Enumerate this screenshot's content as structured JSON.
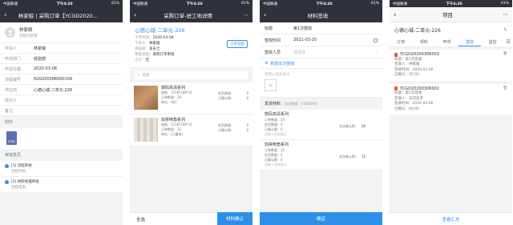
{
  "status": {
    "carrier": "中国联通",
    "time": "下午4:20",
    "battery": "61%"
  },
  "p1": {
    "nav_title": "林家娘 | 采购订单【YCGD2020…",
    "user_name": "林家娘",
    "user_status": "流程已结束",
    "fields": [
      {
        "label": "申请人",
        "value": "林家娘"
      },
      {
        "label": "申请部门",
        "value": "体验部"
      },
      {
        "label": "申请日期",
        "value": "2020-03-06"
      },
      {
        "label": "流程编号",
        "value": "N20200306000156"
      },
      {
        "label": "供应商",
        "value": "心德心城-二单元-226"
      },
      {
        "label": "经办人",
        "value": ""
      },
      {
        "label": "备注",
        "value": ""
      }
    ],
    "attach_title": "附件",
    "attach_label": "HTML",
    "approval_title": "审批意见",
    "approvals": [
      {
        "tag": "[1] 流程开始",
        "detail": "流程开始"
      },
      {
        "tag": "[2] 材料经理审批",
        "detail": "流程结束"
      }
    ]
  },
  "p2": {
    "nav_title": "采购订单-进工地详情",
    "header_title": "心德心城-二单元-226",
    "meta": [
      {
        "label": "下单时间：",
        "value": "2020-03-06"
      },
      {
        "label": "下单人：",
        "value": "林家娘"
      },
      {
        "label": "供应商：",
        "value": "多乐士"
      },
      {
        "label": "审批流程：",
        "value": "采购订单审批"
      },
      {
        "label": "小计：",
        "value": "无"
      }
    ],
    "order_btn": "订单追踪",
    "search_placeholder": "搜索",
    "products": [
      {
        "name": "数码高清系列",
        "spec": "规格：1218*168*12",
        "qty": "订单数量：20",
        "unit": "单位：[块]",
        "sent_label": "发货数量：",
        "sent": "0",
        "confirm_label": "已确认数：",
        "confirm": "0"
      },
      {
        "name": "双拼倒角系列",
        "spec": "规格：1218*168*12",
        "qty": "订单数量：15",
        "unit": "单位：[儿童房]",
        "sent_label": "发货数量：",
        "sent": "0",
        "confirm_label": "已确认数：",
        "confirm": "0"
      }
    ],
    "select_all": "全选",
    "confirm_btn": "材料确认"
  },
  "p3": {
    "nav_title": "材料签收",
    "fields": [
      {
        "label": "标题",
        "value": "第1次签收"
      },
      {
        "label": "签收时间",
        "value": "2021-03-25"
      },
      {
        "label": "签收人员",
        "value": "请选择"
      }
    ],
    "add_signer": "新增本次签收",
    "upload_hint": "请输入签收备注",
    "section_title": "发货材料",
    "section_sub": "（发货数量：0.000000）",
    "items": [
      {
        "name": "数码高清系列",
        "qty": "订单数量：20",
        "sent": "发货数量：0",
        "confirmed": "已确认数：0",
        "this_label": "本次确认数：",
        "this_val": "20",
        "note": "请输入签收备注"
      },
      {
        "name": "双拼倒角系列",
        "qty": "订单数量：15",
        "sent": "发货数量：0",
        "confirmed": "已确认数：0",
        "this_label": "本次确认数：",
        "this_val": "15",
        "note": "请输入签收备注"
      }
    ],
    "submit": "确定"
  },
  "p4": {
    "nav_title": "项目",
    "header_title": "心德心城-二单元-226",
    "tabs": [
      "订单",
      "领料",
      "甲供",
      "签收",
      "监控"
    ],
    "active_tab": "签收",
    "records": [
      {
        "code": "YCGD20200306003",
        "lines": [
          "标题：第1次签收",
          "签收人：林家娘",
          "签收时间：2020-03-06",
          "已确认：35.00"
        ]
      },
      {
        "code": "YCGD20200306002",
        "lines": [
          "标题：第1次签收",
          "签收人：马可波罗",
          "签收时间：2020-03-06",
          "已确认：60.00"
        ]
      }
    ],
    "summary_btn": "查看汇总"
  }
}
